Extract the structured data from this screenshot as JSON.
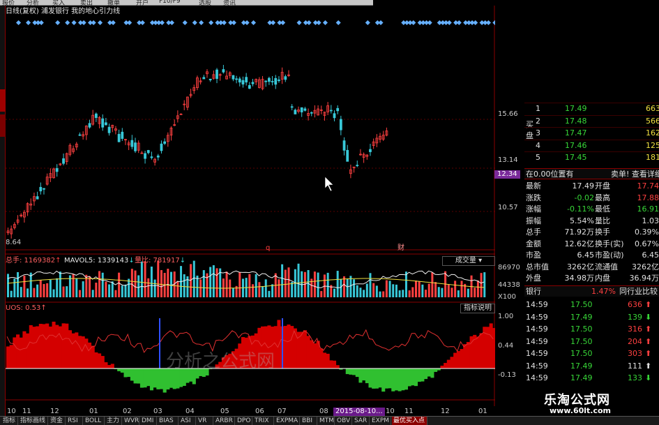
{
  "toolbar": {
    "items": [
      "报价",
      "分析",
      "买入",
      "卖出",
      "撤单",
      "开户",
      "F10/F9",
      "选股",
      "资讯"
    ]
  },
  "header": {
    "title": "日线(复权)  浦发银行  我的地心引力线"
  },
  "price_axis": {
    "labels": [
      "15.66",
      "13.14",
      "12.34",
      "10.57"
    ],
    "low_mark": "8.64",
    "markers": [
      "q",
      "财"
    ]
  },
  "volume": {
    "vol_label": "总手: 1169382",
    "vol_arrow": "↑",
    "mavol_label": "MAVOL5: 1339143",
    "mavol_arrow": "↓",
    "ratio_label": "量比: 781917",
    "ratio_arrow": "↓",
    "dropdown": "成交量",
    "axis": [
      "86970",
      "44338",
      "X100"
    ]
  },
  "uos": {
    "label": "UOS: 0.53",
    "arrow": "↑",
    "button": "指标说明",
    "axis": [
      "1.00",
      "0.44",
      "-0.13"
    ],
    "watermark": "分析之公式网"
  },
  "date_axis": {
    "labels": [
      "10",
      "11",
      "12",
      "01",
      "02",
      "03",
      "04",
      "05",
      "06",
      "07",
      "08",
      "10",
      "11",
      "12",
      "01"
    ],
    "highlight": "2015-08-10..."
  },
  "order_book": {
    "side_label": "买盘",
    "rows": [
      {
        "n": "1",
        "price": "17.49",
        "vol": "663"
      },
      {
        "n": "2",
        "price": "17.48",
        "vol": "566"
      },
      {
        "n": "3",
        "price": "17.47",
        "vol": "162"
      },
      {
        "n": "4",
        "price": "17.46",
        "vol": "125"
      },
      {
        "n": "5",
        "price": "17.45",
        "vol": "181"
      }
    ]
  },
  "position": {
    "left": "在0.00位置有",
    "right": "卖单! 查看详细"
  },
  "quote": [
    {
      "k1": "最新",
      "v1": "17.49",
      "k2": "开盘",
      "v2": "17.74"
    },
    {
      "k1": "涨跌",
      "v1": "-0.02",
      "k2": "最高",
      "v2": "17.88"
    },
    {
      "k1": "涨幅",
      "v1": "-0.11%",
      "k2": "最低",
      "v2": "16.91"
    },
    {
      "k1": "振幅",
      "v1": "5.54%",
      "k2": "量比",
      "v2": "1.03"
    },
    {
      "k1": "总手",
      "v1": "71.92万",
      "k2": "换手",
      "v2": "0.39%"
    },
    {
      "k1": "金额",
      "v1": "12.62亿",
      "k2": "换手(实)",
      "v2": "0.67%"
    },
    {
      "k1": "市盈",
      "v1": "6.45",
      "k2": "市盈(动)",
      "v2": "6.45"
    },
    {
      "k1": "总市值",
      "v1": "3262亿",
      "k2": "流通值",
      "v2": "3262亿"
    },
    {
      "k1": "外盘",
      "v1": "34.98万",
      "k2": "内盘",
      "v2": "36.94万"
    }
  ],
  "industry": {
    "name": "银行",
    "pct": "1.47%",
    "button": "同行业比较"
  },
  "ticks": [
    {
      "t": "14:59",
      "p": "17.50",
      "v": "636",
      "dir": "up"
    },
    {
      "t": "14:59",
      "p": "17.49",
      "v": "139",
      "dir": "dn"
    },
    {
      "t": "14:59",
      "p": "17.50",
      "v": "316",
      "dir": "up"
    },
    {
      "t": "14:59",
      "p": "17.50",
      "v": "204",
      "dir": "up"
    },
    {
      "t": "14:59",
      "p": "17.50",
      "v": "303",
      "dir": "up"
    },
    {
      "t": "14:59",
      "p": "17.49",
      "v": "111",
      "dir": "wh"
    },
    {
      "t": "14:59",
      "p": "17.49",
      "v": "133",
      "dir": "dn"
    }
  ],
  "brand": {
    "name": "乐淘公式网",
    "url": "www.60lt.com"
  },
  "bottom_tabs": [
    "指标",
    "指标画线",
    "资金",
    "RSI",
    "BOLL",
    "主力",
    "WVR",
    "DMI",
    "BIAS",
    "ASI",
    "VR",
    "ARBR",
    "DPO",
    "TRIX",
    "EXPMA",
    "BBI",
    "MTM",
    "OBV",
    "SAR",
    "EXPM",
    "最优买入点"
  ],
  "colors": {
    "up": "#ff4040",
    "down": "#38d838",
    "volume_area": "#d40000",
    "grid": "#8a0000"
  }
}
